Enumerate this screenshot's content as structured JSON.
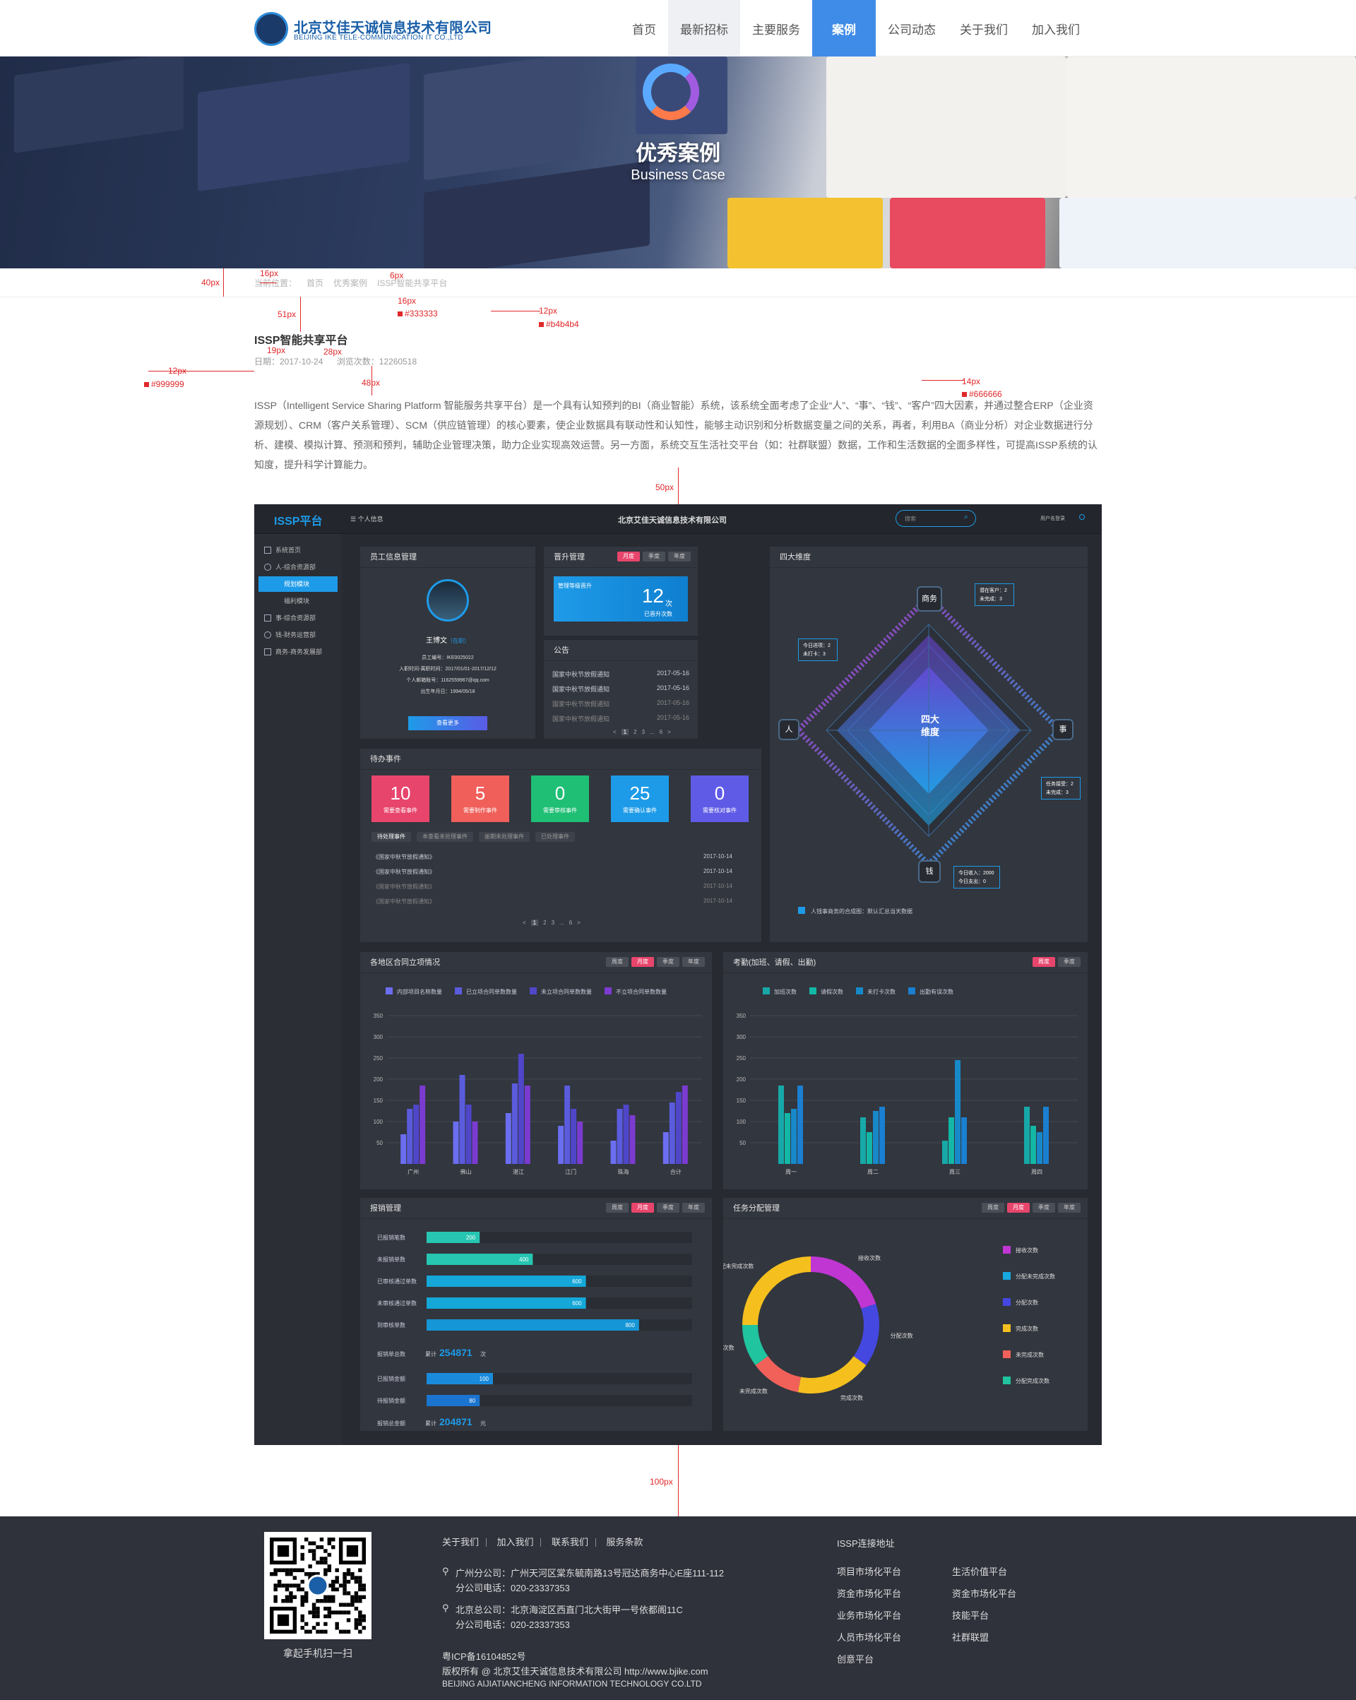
{
  "header": {
    "logo_cn": "北京艾佳天诚信息技术有限公司",
    "logo_en": "BEIJING IKE TELE-COMMUNICATION IT CO.,LTD",
    "nav": [
      "首页",
      "最新招标",
      "主要服务",
      "案例",
      "公司动态",
      "关于我们",
      "加入我们"
    ],
    "nav_active": "案例",
    "nav_hover": "最新招标"
  },
  "banner": {
    "title": "优秀案例",
    "subtitle": "Business Case"
  },
  "breadcrumb": {
    "label": "当前位置：",
    "items": [
      "首页",
      "优秀案例",
      "ISSP智能共享平台"
    ]
  },
  "annotations": {
    "a40": "40px",
    "a16": "16px",
    "a6": "6px",
    "a16b": "16px",
    "a12b": "12px",
    "c333": "#333333",
    "cb4": "#b4b4b4",
    "a51": "51px",
    "a19": "19px",
    "a28": "28px",
    "a12": "12px",
    "c999": "#999999",
    "a48": "48px",
    "a14": "14px",
    "c666": "#666666",
    "a50": "50px",
    "a100": "100px"
  },
  "article": {
    "title": "ISSP智能共享平台",
    "date_label": "日期：2017-10-24",
    "views_label": "浏览次数：12260518",
    "body": "ISSP（Intelligent Service Sharing Platform 智能服务共享平台）是一个具有认知预判的BI（商业智能）系统，该系统全面考虑了企业“人”、“事”、“钱”、“客户”四大因素，并通过整合ERP（企业资源规划）、CRM（客户关系管理）、SCM（供应链管理）的核心要素，使企业数据具有联动性和认知性，能够主动识别和分析数据变量之间的关系，再者，利用BA（商业分析）对企业数据进行分析、建模、模拟计算、预测和预判，辅助企业管理决策，助力企业实现高效运营。另一方面，系统交互生活社交平台（如：社群联盟）数据，工作和生活数据的全面多样性，可提高ISSP系统的认知度，提升科学计算能力。"
  },
  "dashboard": {
    "brand": "ISSP平台",
    "menu_label": "个人信息",
    "company": "北京艾佳天诚信息技术有限公司",
    "search_placeholder": "搜索",
    "user_label": "用户名登录",
    "sidebar": [
      "系统首页",
      "人-综合资源部",
      "规划模块",
      "福利模块",
      "事-综合资源部",
      "钱-财务运营部",
      "商务-商务发展部"
    ],
    "employee": {
      "title": "员工信息管理",
      "name": "王博文",
      "status": "（在职）",
      "fields": [
        "员工编号：IKE0025022",
        "入职时间-离职时间：2017/01/01-2017/12/12",
        "个人邮箱账号：1162559967@qq.com",
        "出生年月日：1994/05/18"
      ],
      "button": "查看更多"
    },
    "promotion": {
      "title": "晋升管理",
      "tabs": [
        "月度",
        "季度",
        "年度"
      ],
      "label": "管理等级晋升",
      "value": "12",
      "unit": "次",
      "caption": "已晋升次数"
    },
    "notice": {
      "title": "公告",
      "rows": [
        {
          "text": "国家中秋节放假通知",
          "date": "2017-05-16"
        },
        {
          "text": "国家中秋节放假通知",
          "date": "2017-05-16"
        },
        {
          "text": "国家中秋节放假通知",
          "date": "2017-05-16"
        },
        {
          "text": "国家中秋节放假通知",
          "date": "2017-05-16"
        }
      ],
      "pager": [
        "<",
        "1",
        "2",
        "3",
        "...",
        "6",
        ">"
      ]
    },
    "four": {
      "title": "四大维度",
      "center": "四大\n维度",
      "nodes": [
        "商务",
        "人",
        "事",
        "钱"
      ],
      "info_top": [
        "潜在客户：2",
        "未完成：3"
      ],
      "info_left": [
        "今日进项：2",
        "未打卡：3"
      ],
      "info_right": [
        "任务接受：2",
        "未完成：3"
      ],
      "info_bottom": [
        "今日收入：2000",
        "今日支出：0"
      ],
      "legend": "人钱事商务的合成图：默认汇总当天数据"
    },
    "todo": {
      "title": "待办事件",
      "stats": [
        {
          "n": "10",
          "l": "需要查看事件",
          "c": "#e8456c"
        },
        {
          "n": "5",
          "l": "需要制作事件",
          "c": "#f05f5a"
        },
        {
          "n": "0",
          "l": "需要审核事件",
          "c": "#1fbf75"
        },
        {
          "n": "25",
          "l": "需要确认事件",
          "c": "#1e9be8"
        },
        {
          "n": "0",
          "l": "需要核对事件",
          "c": "#5f5be6"
        }
      ],
      "filters": [
        "待处理事件",
        "本查看未处理事件",
        "逾期未处理事件",
        "已处理事件"
      ],
      "rows": [
        {
          "text": "《国家中秋节放假通知》",
          "date": "2017-10-14"
        },
        {
          "text": "《国家中秋节放假通知》",
          "date": "2017-10-14"
        },
        {
          "text": "《国家中秋节放假通知》",
          "date": "2017-10-14"
        },
        {
          "text": "《国家中秋节放假通知》",
          "date": "2017-10-14"
        }
      ],
      "pager": [
        "<",
        "1",
        "2",
        "3",
        "...",
        "6",
        ">"
      ]
    },
    "contracts": {
      "title": "各地区合同立项情况",
      "tabs": [
        "周度",
        "月度",
        "季度",
        "年度"
      ]
    },
    "attendance": {
      "title": "考勤(加班、请假、出勤)",
      "tabs": [
        "周度",
        "季度"
      ]
    },
    "reimburse": {
      "title": "报销管理",
      "tabs": [
        "周度",
        "月度",
        "季度",
        "年度"
      ],
      "total_prefix": "累计",
      "total1_label": "报销单总数",
      "total1": "254871",
      "total1_unit": "次",
      "total2_label": "报销总金额",
      "total2": "204871",
      "total2_unit": "元"
    },
    "task": {
      "title": "任务分配管理",
      "tabs": [
        "周度",
        "月度",
        "季度",
        "年度"
      ]
    }
  },
  "chart_data": [
    {
      "type": "bar",
      "title": "各地区合同立项情况",
      "categories": [
        "广州",
        "佛山",
        "湛江",
        "江门",
        "珠海",
        "合计"
      ],
      "ylim": [
        0,
        350
      ],
      "yticks": [
        50,
        100,
        150,
        200,
        250,
        300,
        350
      ],
      "series": [
        {
          "name": "内部项目名称数量",
          "color": "#6b6ef0",
          "values": [
            70,
            100,
            120,
            90,
            55,
            75
          ]
        },
        {
          "name": "已立项合同单数数量",
          "color": "#5b5bdd",
          "values": [
            130,
            210,
            190,
            185,
            130,
            145
          ]
        },
        {
          "name": "未立项合同单数数量",
          "color": "#4f46c9",
          "values": [
            140,
            140,
            260,
            130,
            140,
            170
          ]
        },
        {
          "name": "不立项合同单数数量",
          "color": "#7b3bd1",
          "values": [
            185,
            100,
            185,
            100,
            115,
            185
          ]
        }
      ],
      "grid": true,
      "legend": "top"
    },
    {
      "type": "bar",
      "title": "考勤(加班、请假、出勤)",
      "categories": [
        "周一",
        "周二",
        "周三",
        "周四"
      ],
      "ylim": [
        0,
        350
      ],
      "yticks": [
        50,
        100,
        150,
        200,
        250,
        300,
        350
      ],
      "series": [
        {
          "name": "加班次数",
          "color": "#17a8a8",
          "values": [
            185,
            110,
            55,
            135
          ]
        },
        {
          "name": "请假次数",
          "color": "#12b7a6",
          "values": [
            120,
            75,
            110,
            90
          ]
        },
        {
          "name": "未打卡次数",
          "color": "#1789c9",
          "values": [
            130,
            125,
            245,
            75
          ]
        },
        {
          "name": "出勤有误次数",
          "color": "#1a7fd0",
          "values": [
            185,
            135,
            110,
            135
          ]
        }
      ],
      "grid": true,
      "legend": "top"
    },
    {
      "type": "bar",
      "title": "报销管理",
      "orientation": "horizontal",
      "max": 1000,
      "groups": [
        {
          "items": [
            {
              "label": "已报销笔数",
              "value": 200,
              "color": "#26c6b2"
            },
            {
              "label": "未报销单数",
              "value": 400,
              "color": "#26c6b2"
            },
            {
              "label": "已审核通过单数",
              "value": 600,
              "color": "#14a7d8"
            },
            {
              "label": "未审核通过单数",
              "value": 600,
              "color": "#14a7d8"
            },
            {
              "label": "到审核单数",
              "value": 800,
              "color": "#1596d6"
            }
          ]
        },
        {
          "items": [
            {
              "label": "已报销金额",
              "value": 100,
              "color": "#1a8bdc"
            },
            {
              "label": "待报销金额",
              "value": 80,
              "color": "#1a74d0"
            }
          ]
        }
      ]
    },
    {
      "type": "pie",
      "title": "任务分配管理",
      "donut": true,
      "slices": [
        {
          "name": "接收次数",
          "color": "#c036d3",
          "value": 20
        },
        {
          "name": "分配未完成次数",
          "color": "#18a8e0",
          "value": 0
        },
        {
          "name": "分配次数",
          "color": "#4448e0",
          "value": 15
        },
        {
          "name": "完成次数",
          "color": "#f5c01e",
          "value": 18
        },
        {
          "name": "未完成次数",
          "color": "#f1615a",
          "value": 12
        },
        {
          "name": "分配完成次数",
          "color": "#20c49e",
          "value": 10
        },
        {
          "name": "分配未完成次数",
          "color": "#f5c01e",
          "value": 25
        }
      ],
      "legend": "right"
    }
  ],
  "footer": {
    "links": [
      "关于我们",
      "加入我们",
      "联系我们",
      "服务条款"
    ],
    "gz_addr": "广州分公司：广州天河区棠东毓南路13号冠达商务中心E座111-112",
    "gz_tel": "分公司电话：020-23337353",
    "bj_addr": "北京总公司：北京海淀区西直门北大街甲一号依都阁11C",
    "bj_tel": "分公司电话：020-23337353",
    "icp": "粤ICP备16104852号",
    "copyright": "版权所有 @ 北京艾佳天诚信息技术有限公司 http://www.bjike.com",
    "copyright_en": "BEIJING AIJIATIANCHENG INFORMATION TECHNOLOGY CO.LTD",
    "qr_caption": "拿起手机扫一扫",
    "issp_title": "ISSP连接地址",
    "issp_links": [
      "项目市场化平台",
      "生活价值平台",
      "资金市场化平台",
      "资金市场化平台",
      "业务市场化平台",
      "技能平台",
      "人员市场化平台",
      "社群联盟",
      "创意平台"
    ]
  }
}
